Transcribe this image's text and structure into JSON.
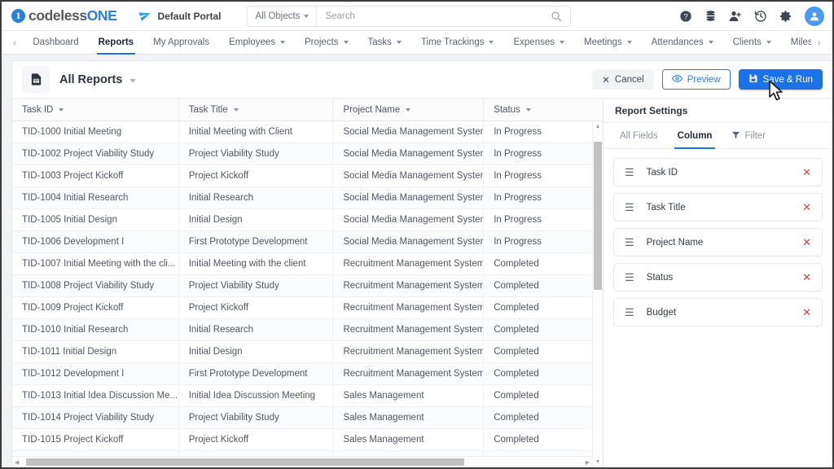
{
  "brand": {
    "name_dark": "codeless",
    "name_blue": "ONE",
    "accent": "#2b7fd4"
  },
  "topbar": {
    "portal_label": "Default Portal",
    "portal_icon": "send-icon",
    "object_filter": "All Objects",
    "search_placeholder": "Search",
    "search_value": "",
    "icons": [
      {
        "name": "help-icon",
        "glyph": "?"
      },
      {
        "name": "database-icon",
        "glyph": "db"
      },
      {
        "name": "add-user-icon",
        "glyph": "user+"
      },
      {
        "name": "history-icon",
        "glyph": "history"
      },
      {
        "name": "gear-icon",
        "glyph": "gear"
      },
      {
        "name": "avatar-icon",
        "glyph": "user"
      }
    ]
  },
  "nav": {
    "prev_label": "‹",
    "next_label": "›",
    "items": [
      {
        "label": "Dashboard",
        "dropdown": false,
        "active": false
      },
      {
        "label": "Reports",
        "dropdown": false,
        "active": true
      },
      {
        "label": "My Approvals",
        "dropdown": false,
        "active": false
      },
      {
        "label": "Employees",
        "dropdown": true,
        "active": false
      },
      {
        "label": "Projects",
        "dropdown": true,
        "active": false
      },
      {
        "label": "Tasks",
        "dropdown": true,
        "active": false
      },
      {
        "label": "Time Trackings",
        "dropdown": true,
        "active": false
      },
      {
        "label": "Expenses",
        "dropdown": true,
        "active": false
      },
      {
        "label": "Meetings",
        "dropdown": true,
        "active": false
      },
      {
        "label": "Attendances",
        "dropdown": true,
        "active": false
      },
      {
        "label": "Clients",
        "dropdown": true,
        "active": false
      },
      {
        "label": "Milestones",
        "dropdown": true,
        "active": false
      }
    ]
  },
  "card": {
    "title": "All Reports",
    "icon": "report-document-icon",
    "buttons": {
      "cancel": "Cancel",
      "preview": "Preview",
      "save_run": "Save & Run"
    },
    "save_color": "#1a73e8"
  },
  "table": {
    "columns": [
      "Task ID",
      "Task Title",
      "Project Name",
      "Status"
    ],
    "rows": [
      [
        "TID-1000 Initial Meeting",
        "Initial Meeting with Client",
        "Social Media Management System",
        "In Progress"
      ],
      [
        "TID-1002 Project Viability Study",
        "Project Viability Study",
        "Social Media Management System",
        "In Progress"
      ],
      [
        "TID-1003 Project Kickoff",
        "Project Kickoff",
        "Social Media Management System",
        "In Progress"
      ],
      [
        "TID-1004 Initial Research",
        "Initial Research",
        "Social Media Management System",
        "In Progress"
      ],
      [
        "TID-1005 Initial Design",
        "Initial Design",
        "Social Media Management System",
        "In Progress"
      ],
      [
        "TID-1006 Development I",
        "First Prototype Development",
        "Social Media Management System",
        "In Progress"
      ],
      [
        "TID-1007 Initial Meeting with the cli...",
        "Initial Meeting with the client",
        "Recruitment Management System",
        "Completed"
      ],
      [
        "TID-1008 Project Viability Study",
        "Project Viability Study",
        "Recruitment Management System",
        "Completed"
      ],
      [
        "TID-1009 Project Kickoff",
        "Project Kickoff",
        "Recruitment Management System",
        "Completed"
      ],
      [
        "TID-1010 Initial Research",
        "Initial Research",
        "Recruitment Management System",
        "Completed"
      ],
      [
        "TID-1011 Initial Design",
        "Initial Design",
        "Recruitment Management System",
        "Completed"
      ],
      [
        "TID-1012 Development I",
        "First Prototype Development",
        "Recruitment Management System",
        "Completed"
      ],
      [
        "TID-1013 Initial Idea Discussion Me...",
        "Initial Idea Discussion Meeting",
        "Sales Management",
        "Completed"
      ],
      [
        "TID-1014 Project Viability Study",
        "Project Viability Study",
        "Sales Management",
        "Completed"
      ],
      [
        "TID-1015 Project Kickoff",
        "Project Kickoff",
        "Sales Management",
        "Completed"
      ],
      [
        "",
        "",
        "",
        ""
      ]
    ]
  },
  "panel": {
    "title": "Report Settings",
    "tabs": [
      {
        "label": "All Fields",
        "active": false,
        "icon": ""
      },
      {
        "label": "Column",
        "active": true,
        "icon": ""
      },
      {
        "label": "Filter",
        "active": false,
        "icon": "filter-icon"
      }
    ],
    "columns": [
      {
        "label": "Task ID",
        "remove": "✕"
      },
      {
        "label": "Task Title",
        "remove": "✕"
      },
      {
        "label": "Project Name",
        "remove": "✕"
      },
      {
        "label": "Status",
        "remove": "✕"
      },
      {
        "label": "Budget",
        "remove": "✕"
      }
    ],
    "remove_color": "#e03b3b"
  }
}
